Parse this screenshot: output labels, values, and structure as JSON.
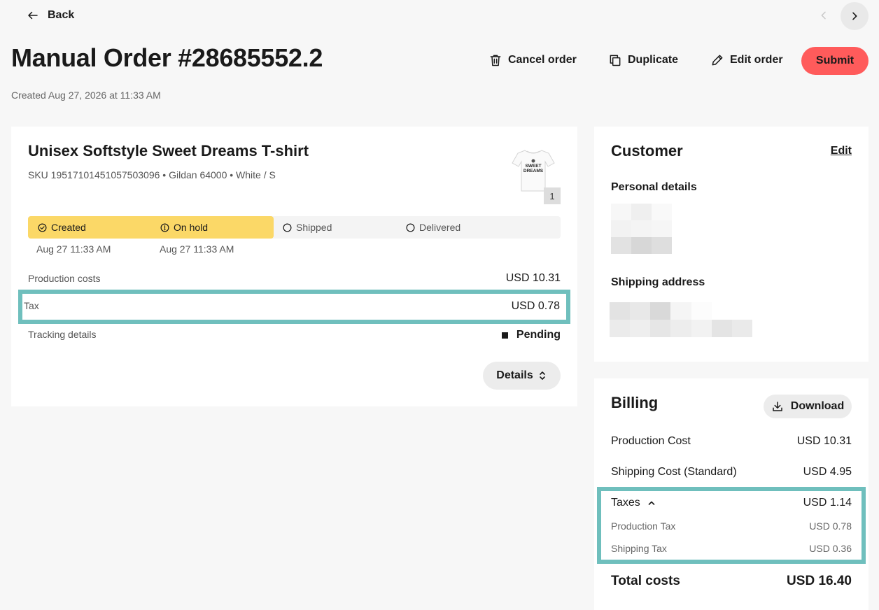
{
  "nav": {
    "back_label": "Back"
  },
  "header": {
    "title": "Manual Order #28685552.2",
    "created": "Created Aug 27, 2026 at 11:33 AM",
    "cancel_label": "Cancel order",
    "duplicate_label": "Duplicate",
    "edit_label": "Edit order",
    "submit_label": "Submit"
  },
  "product": {
    "title": "Unisex Softstyle Sweet Dreams T-shirt",
    "subtitle": "SKU 19517101451057503096 • Gildan 64000 • White / S",
    "quantity": "1",
    "thumbnail_text": "SWEET DREAMS",
    "steps": [
      {
        "label": "Created",
        "date": "Aug 27 11:33 AM"
      },
      {
        "label": "On hold",
        "date": "Aug 27 11:33 AM"
      },
      {
        "label": "Shipped"
      },
      {
        "label": "Delivered"
      }
    ],
    "production_costs_label": "Production costs",
    "production_costs_value": "USD 10.31",
    "tax_label": "Tax",
    "tax_value": "USD 0.78",
    "tracking_label": "Tracking details",
    "tracking_value": "Pending",
    "details_label": "Details"
  },
  "customer": {
    "title": "Customer",
    "edit_label": "Edit",
    "personal_details_label": "Personal details",
    "shipping_address_label": "Shipping address"
  },
  "billing": {
    "title": "Billing",
    "download_label": "Download",
    "production_cost_label": "Production Cost",
    "production_cost_value": "USD 10.31",
    "shipping_cost_label": "Shipping Cost (Standard)",
    "shipping_cost_value": "USD 4.95",
    "taxes_label": "Taxes",
    "taxes_value": "USD 1.14",
    "production_tax_label": "Production Tax",
    "production_tax_value": "USD 0.78",
    "shipping_tax_label": "Shipping Tax",
    "shipping_tax_value": "USD 0.36",
    "total_label": "Total costs",
    "total_value": "USD 16.40"
  },
  "colors": {
    "accent_submit": "#ff5b5b",
    "progress": "#fbd867",
    "highlight": "#6fbfbd"
  }
}
